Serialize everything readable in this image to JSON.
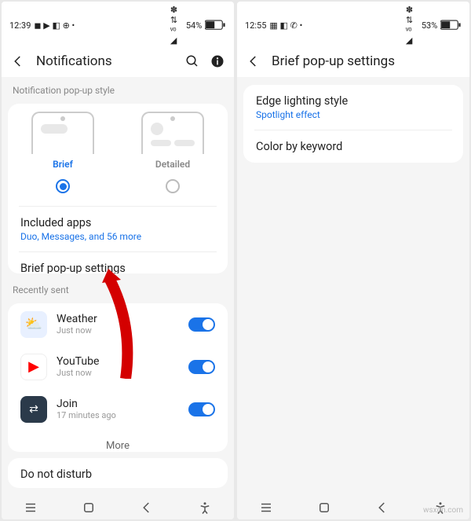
{
  "left": {
    "status": {
      "time": "12:39",
      "battery": "54%",
      "icons_left": "◼ ▶ ◧ ⊕ •",
      "icons_right": "✽ ⇅ ᵛᵒ ◢"
    },
    "header": {
      "title": "Notifications"
    },
    "section_label": "Notification pop-up style",
    "popup": {
      "brief": "Brief",
      "detailed": "Detailed"
    },
    "included": {
      "title": "Included apps",
      "sub": "Duo, Messages, and 56 more"
    },
    "brief_popup": "Brief pop-up settings",
    "recently_sent": "Recently sent",
    "apps": [
      {
        "name": "Weather",
        "time": "Just now",
        "bg": "#e8f0ff",
        "glyph": "⛅"
      },
      {
        "name": "YouTube",
        "time": "Just now",
        "bg": "#fff",
        "glyph": "▶",
        "gcolor": "#ff0000"
      },
      {
        "name": "Join",
        "time": "17 minutes ago",
        "bg": "#2b3a4a",
        "glyph": "⇄",
        "gcolor": "#fff"
      }
    ],
    "more": "More",
    "dnd": "Do not disturb"
  },
  "right": {
    "status": {
      "time": "12:55",
      "battery": "53%",
      "icons_left": "▦ ◧ ✆ •",
      "icons_right": "✽ ⇅ ᵛᵒ ◢"
    },
    "header": {
      "title": "Brief pop-up settings"
    },
    "items": [
      {
        "title": "Edge lighting style",
        "sub": "Spotlight effect"
      },
      {
        "title": "Color by keyword"
      }
    ]
  },
  "watermark": "wsxdn.com"
}
